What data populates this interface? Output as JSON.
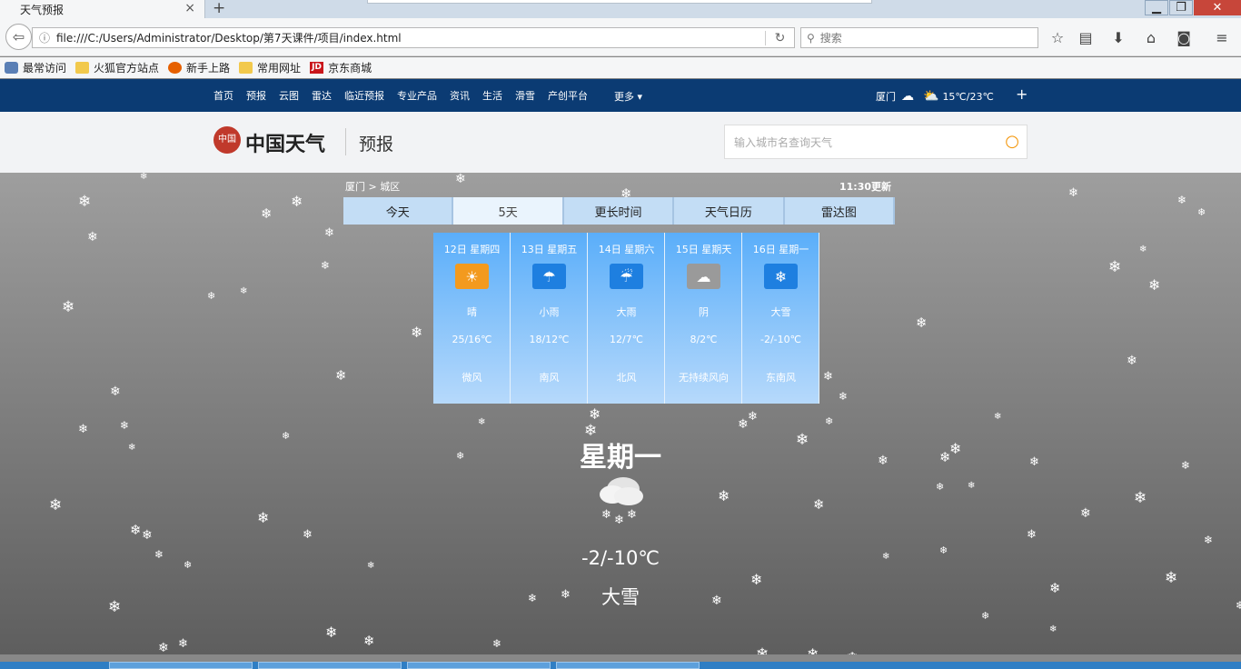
{
  "browser": {
    "tab_title": "天气预报",
    "tab_close": "×",
    "new_tab": "+",
    "window": {
      "minimize": "▁",
      "maximize": "❐",
      "close": "✕"
    },
    "back_glyph": "⇦",
    "info_glyph": "ⓘ",
    "url": "file:///C:/Users/Administrator/Desktop/第7天课件/项目/index.html",
    "reload_glyph": "↻",
    "search_placeholder": "搜索",
    "search_glyph": "⚲",
    "toolbar_icons": [
      {
        "name": "bookmark-star-icon",
        "glyph": "☆"
      },
      {
        "name": "reading-list-icon",
        "glyph": "▤"
      },
      {
        "name": "download-icon",
        "glyph": "⬇"
      },
      {
        "name": "home-icon",
        "glyph": "⌂"
      },
      {
        "name": "pocket-icon",
        "glyph": "◙"
      },
      {
        "name": "menu-icon",
        "glyph": "≡"
      }
    ],
    "bookmarks": [
      {
        "label": "最常访问",
        "icon": "star"
      },
      {
        "label": "火狐官方站点",
        "icon": "folder"
      },
      {
        "label": "新手上路",
        "icon": "fox"
      },
      {
        "label": "常用网址",
        "icon": "folder"
      },
      {
        "label": "京东商城",
        "icon": "jd"
      }
    ],
    "jd_badge": "JD"
  },
  "site": {
    "nav_links": [
      "首页",
      "预报",
      "云图",
      "雷达",
      "临近预报",
      "专业产品",
      "资讯",
      "生活",
      "滑雪",
      "产创平台"
    ],
    "nav_more": "更多 ▾",
    "city": "厦门",
    "cloud_glyph": "☁",
    "weather_glyph": "⛅",
    "temp_range": "15℃/23℃",
    "add_glyph": "+",
    "logo_seal": "中国",
    "logo_text": "中国天气",
    "logo_sub": "预报",
    "city_search_placeholder": "输入城市名查询天气",
    "city_search_glyph": "○",
    "breadcrumb": "厦门 > 城区",
    "updated": "11:30更新",
    "tabs": [
      "今天",
      "5天",
      "更长时间",
      "天气日历",
      "雷达图"
    ],
    "active_tab": 1,
    "forecast": [
      {
        "date": "12日 星期四",
        "desc": "晴",
        "temp": "25/16℃",
        "wind": "微风",
        "icon": "sunny-icon",
        "glyph": "☀",
        "color": "#f39a1e"
      },
      {
        "date": "13日 星期五",
        "desc": "小雨",
        "temp": "18/12℃",
        "wind": "南风",
        "icon": "light-rain-icon",
        "glyph": "☂",
        "color": "#1e7fe0"
      },
      {
        "date": "14日 星期六",
        "desc": "大雨",
        "temp": "12/7℃",
        "wind": "北风",
        "icon": "heavy-rain-icon",
        "glyph": "☔",
        "color": "#1e7fe0"
      },
      {
        "date": "15日 星期天",
        "desc": "阴",
        "temp": "8/2℃",
        "wind": "无持续风向",
        "icon": "overcast-icon",
        "glyph": "☁",
        "color": "#9a9a9a"
      },
      {
        "date": "16日 星期一",
        "desc": "大雪",
        "temp": "-2/-10℃",
        "wind": "东南风",
        "icon": "heavy-snow-icon",
        "glyph": "❄",
        "color": "#1e7fe0"
      }
    ],
    "current": {
      "day": "星期一",
      "temp": "-2/-10℃",
      "desc": "大雪",
      "icon": "heavy-snow-icon"
    },
    "snow_glyph": "❄"
  }
}
